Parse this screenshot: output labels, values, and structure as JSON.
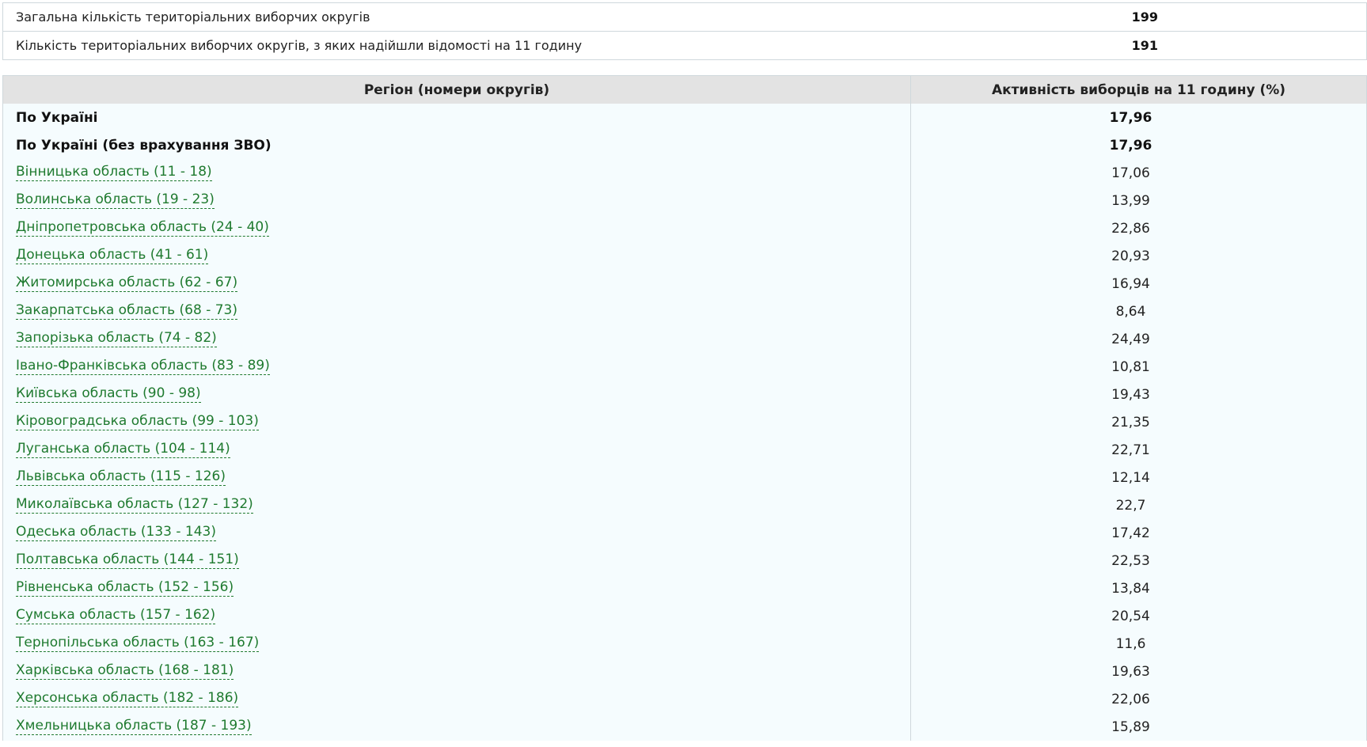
{
  "summary": [
    {
      "label": "Загальна кількість територіальних виборчих округів",
      "value": "199"
    },
    {
      "label": "Кількість територіальних виборчих округів, з яких надійшли відомості на 11 годину",
      "value": "191"
    }
  ],
  "table": {
    "headers": {
      "region": "Регіон (номери округів)",
      "activity": "Активність виборців на 11 годину (%)"
    },
    "totals": [
      {
        "region": "По Україні",
        "activity": "17,96"
      },
      {
        "region": "По Україні (без врахування ЗВО)",
        "activity": "17,96"
      }
    ],
    "rows": [
      {
        "region": "Вінницька область (11 - 18)",
        "activity": "17,06"
      },
      {
        "region": "Волинська область (19 - 23)",
        "activity": "13,99"
      },
      {
        "region": "Дніпропетровська область (24 - 40)",
        "activity": "22,86"
      },
      {
        "region": "Донецька область (41 - 61)",
        "activity": "20,93"
      },
      {
        "region": "Житомирська область (62 - 67)",
        "activity": "16,94"
      },
      {
        "region": "Закарпатська область (68 - 73)",
        "activity": "8,64"
      },
      {
        "region": "Запорізька область (74 - 82)",
        "activity": "24,49"
      },
      {
        "region": "Івано-Франківська область (83 - 89)",
        "activity": "10,81"
      },
      {
        "region": "Київська область (90 - 98)",
        "activity": "19,43"
      },
      {
        "region": "Кіровоградська область (99 - 103)",
        "activity": "21,35"
      },
      {
        "region": "Луганська область (104 - 114)",
        "activity": "22,71"
      },
      {
        "region": "Львівська область (115 - 126)",
        "activity": "12,14"
      },
      {
        "region": "Миколаївська область (127 - 132)",
        "activity": "22,7"
      },
      {
        "region": "Одеська область (133 - 143)",
        "activity": "17,42"
      },
      {
        "region": "Полтавська область (144 - 151)",
        "activity": "22,53"
      },
      {
        "region": "Рівненська область (152 - 156)",
        "activity": "13,84"
      },
      {
        "region": "Сумська область (157 - 162)",
        "activity": "20,54"
      },
      {
        "region": "Тернопільська область (163 - 167)",
        "activity": "11,6"
      },
      {
        "region": "Харківська область (168 - 181)",
        "activity": "19,63"
      },
      {
        "region": "Херсонська область (182 - 186)",
        "activity": "22,06"
      },
      {
        "region": "Хмельницька область (187 - 193)",
        "activity": "15,89"
      }
    ]
  },
  "colors": {
    "link": "#1f7a2f",
    "header_bg": "#e3e3e3",
    "row_bg": "#f5fcfe",
    "border": "#cfd8dc"
  }
}
